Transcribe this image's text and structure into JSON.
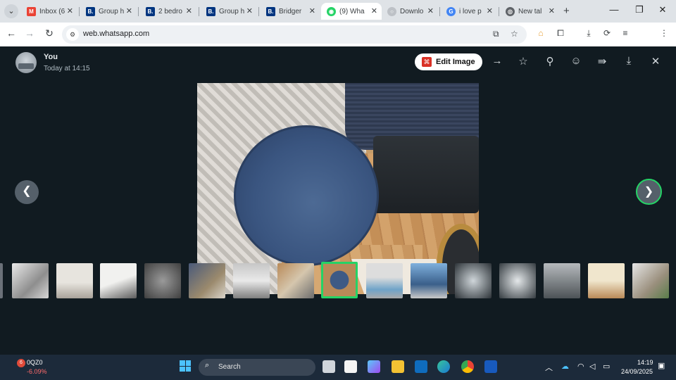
{
  "browser": {
    "tabs": [
      {
        "label": "Inbox (6",
        "icon": "gmail-icon",
        "color": "#ea4335",
        "glyph": "M"
      },
      {
        "label": "Group h",
        "icon": "booking-icon",
        "color": "#003580",
        "glyph": "B."
      },
      {
        "label": "2 bedro",
        "icon": "booking-icon",
        "color": "#003580",
        "glyph": "B."
      },
      {
        "label": "Group h",
        "icon": "booking-icon",
        "color": "#003580",
        "glyph": "B."
      },
      {
        "label": "Bridger",
        "icon": "booking-icon",
        "color": "#003580",
        "glyph": "B."
      },
      {
        "label": "(9) Wha",
        "icon": "whatsapp-icon",
        "color": "#25d366",
        "glyph": "◉"
      },
      {
        "label": "Downlo",
        "icon": "loading-icon",
        "color": "#bdc1c6",
        "glyph": "○"
      },
      {
        "label": "i love p",
        "icon": "google-icon",
        "color": "#4285f4",
        "glyph": "G"
      },
      {
        "label": "New tal",
        "icon": "chrome-icon",
        "color": "#5f6368",
        "glyph": "◎"
      }
    ],
    "active_tab": 5,
    "url": "web.whatsapp.com",
    "profile_initial": "S"
  },
  "viewer": {
    "sender_name": "You",
    "sent_time": "Today at 14:15",
    "edit_label": "Edit Image",
    "thumbnails_count": 16,
    "selected_thumbnail": 7
  },
  "taskbar": {
    "stock_badge": "6",
    "stock_name": "0QZ0",
    "stock_change": "-6.09%",
    "search_label": "Search",
    "time": "14:19",
    "date": "24/09/2025",
    "chrome_badge": "S"
  }
}
